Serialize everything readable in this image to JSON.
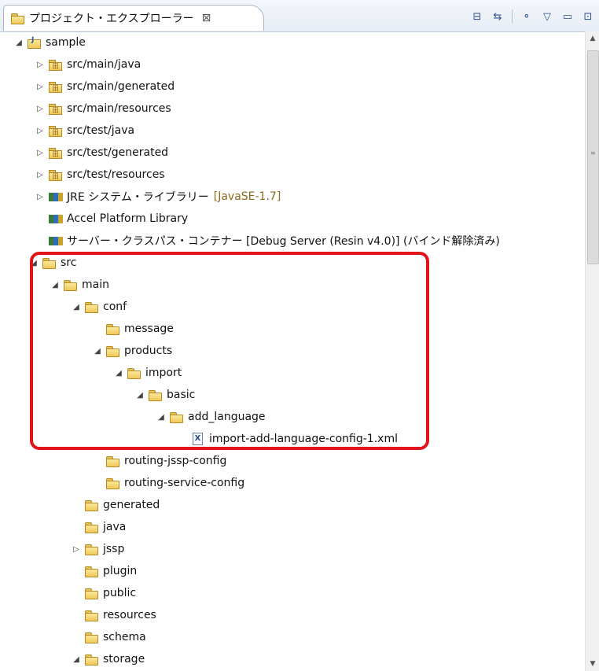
{
  "view": {
    "tab_title": "プロジェクト・エクスプローラー",
    "tab_close_glyph": "⊠",
    "toolbar": [
      {
        "name": "collapse-all-icon",
        "glyph": "⊟"
      },
      {
        "name": "link-editor-icon",
        "glyph": "⇆"
      },
      {
        "name": "separator"
      },
      {
        "name": "filters-icon",
        "glyph": "⚬"
      },
      {
        "name": "view-menu-icon",
        "glyph": "▽"
      },
      {
        "name": "minimize-icon",
        "glyph": "▭"
      },
      {
        "name": "maximize-icon",
        "glyph": "⊡"
      }
    ]
  },
  "tree": [
    {
      "label": "sample",
      "icon": "project",
      "twisty": "open",
      "level": 0
    },
    {
      "label": "src/main/java",
      "icon": "srcfolder",
      "twisty": "closed",
      "level": 1
    },
    {
      "label": "src/main/generated",
      "icon": "srcfolder",
      "twisty": "closed",
      "level": 1
    },
    {
      "label": "src/main/resources",
      "icon": "srcfolder",
      "twisty": "closed",
      "level": 1
    },
    {
      "label": "src/test/java",
      "icon": "srcfolder",
      "twisty": "closed",
      "level": 1
    },
    {
      "label": "src/test/generated",
      "icon": "srcfolder",
      "twisty": "closed",
      "level": 1
    },
    {
      "label": "src/test/resources",
      "icon": "srcfolder",
      "twisty": "closed",
      "level": 1
    },
    {
      "label": "JRE システム・ライブラリー",
      "decoration": "[JavaSE-1.7]",
      "icon": "library",
      "twisty": "closed",
      "level": 1
    },
    {
      "label": "Accel Platform Library",
      "icon": "library",
      "twisty": "none",
      "level": 1
    },
    {
      "label": "サーバー・クラスパス・コンテナー [Debug Server (Resin v4.0)] (バインド解除済み)",
      "icon": "library",
      "twisty": "none",
      "level": 1
    },
    {
      "label": "src",
      "icon": "folder",
      "twisty": "open",
      "level": 0.7
    },
    {
      "label": "main",
      "icon": "folder",
      "twisty": "open",
      "level": 1.7
    },
    {
      "label": "conf",
      "icon": "folder",
      "twisty": "open",
      "level": 2.7
    },
    {
      "label": "message",
      "icon": "folder",
      "twisty": "none",
      "level": 3.7
    },
    {
      "label": "products",
      "icon": "folder",
      "twisty": "open",
      "level": 3.7
    },
    {
      "label": "import",
      "icon": "folder",
      "twisty": "open",
      "level": 4.7
    },
    {
      "label": "basic",
      "icon": "folder",
      "twisty": "open",
      "level": 5.7
    },
    {
      "label": "add_language",
      "icon": "folder",
      "twisty": "open",
      "level": 6.7
    },
    {
      "label": "import-add-language-config-1.xml",
      "icon": "xmlfile",
      "twisty": "none",
      "level": 7.7
    },
    {
      "label": "routing-jssp-config",
      "icon": "folder",
      "twisty": "none",
      "level": 3.7
    },
    {
      "label": "routing-service-config",
      "icon": "folder",
      "twisty": "none",
      "level": 3.7
    },
    {
      "label": "generated",
      "icon": "folder",
      "twisty": "none",
      "level": 2.7
    },
    {
      "label": "java",
      "icon": "folder",
      "twisty": "none",
      "level": 2.7
    },
    {
      "label": "jssp",
      "icon": "folder",
      "twisty": "closed",
      "level": 2.7
    },
    {
      "label": "plugin",
      "icon": "folder",
      "twisty": "none",
      "level": 2.7
    },
    {
      "label": "public",
      "icon": "folder",
      "twisty": "none",
      "level": 2.7
    },
    {
      "label": "resources",
      "icon": "folder",
      "twisty": "none",
      "level": 2.7
    },
    {
      "label": "schema",
      "icon": "folder",
      "twisty": "none",
      "level": 2.7
    },
    {
      "label": "storage",
      "icon": "folder",
      "twisty": "open",
      "level": 2.7
    }
  ],
  "highlight_color": "#e0141a"
}
